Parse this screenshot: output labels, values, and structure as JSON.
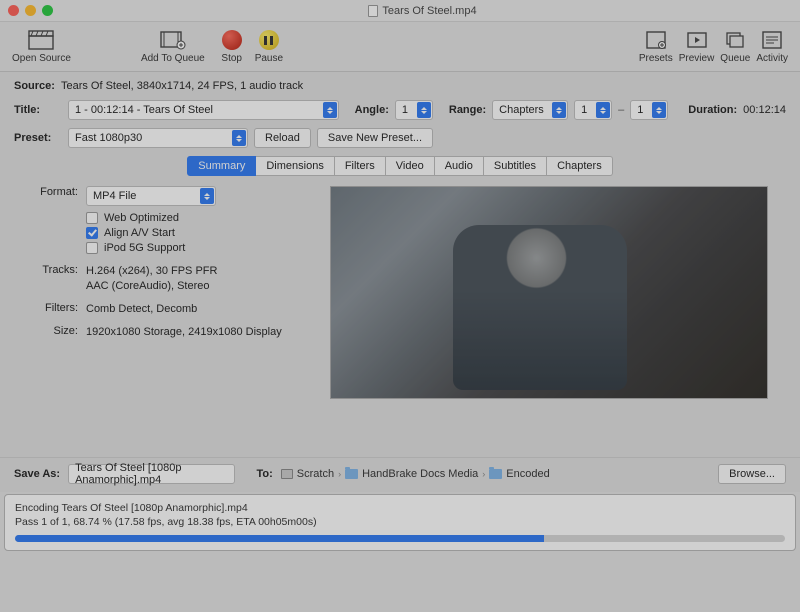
{
  "window": {
    "title": "Tears Of Steel.mp4"
  },
  "toolbar": {
    "open_source": "Open Source",
    "add_to_queue": "Add To Queue",
    "stop": "Stop",
    "pause": "Pause",
    "presets": "Presets",
    "preview": "Preview",
    "queue": "Queue",
    "activity": "Activity"
  },
  "source": {
    "label": "Source:",
    "value": "Tears Of Steel, 3840x1714, 24 FPS, 1 audio track"
  },
  "title": {
    "label": "Title:",
    "value": "1 - 00:12:14 - Tears Of Steel",
    "angle_label": "Angle:",
    "angle_value": "1",
    "range_label": "Range:",
    "range_type": "Chapters",
    "range_from": "1",
    "range_to": "1",
    "duration_label": "Duration:",
    "duration_value": "00:12:14"
  },
  "preset": {
    "label": "Preset:",
    "value": "Fast 1080p30",
    "reload": "Reload",
    "save_new": "Save New Preset..."
  },
  "tabs": [
    "Summary",
    "Dimensions",
    "Filters",
    "Video",
    "Audio",
    "Subtitles",
    "Chapters"
  ],
  "summary": {
    "format_label": "Format:",
    "format_value": "MP4 File",
    "web_optimized": "Web Optimized",
    "align_av": "Align A/V Start",
    "ipod": "iPod 5G Support",
    "tracks_label": "Tracks:",
    "tracks_value": "H.264 (x264), 30 FPS PFR\nAAC (CoreAudio), Stereo",
    "filters_label": "Filters:",
    "filters_value": "Comb Detect, Decomb",
    "size_label": "Size:",
    "size_value": "1920x1080 Storage, 2419x1080 Display"
  },
  "saveas": {
    "label": "Save As:",
    "filename": "Tears Of Steel [1080p Anamorphic].mp4",
    "to_label": "To:",
    "path": [
      "Scratch",
      "HandBrake Docs Media",
      "Encoded"
    ],
    "browse": "Browse..."
  },
  "status": {
    "line1": "Encoding Tears Of Steel [1080p Anamorphic].mp4",
    "line2": "Pass 1 of 1, 68.74 % (17.58 fps, avg 18.38 fps, ETA 00h05m00s)",
    "progress_pct": 68.74
  }
}
